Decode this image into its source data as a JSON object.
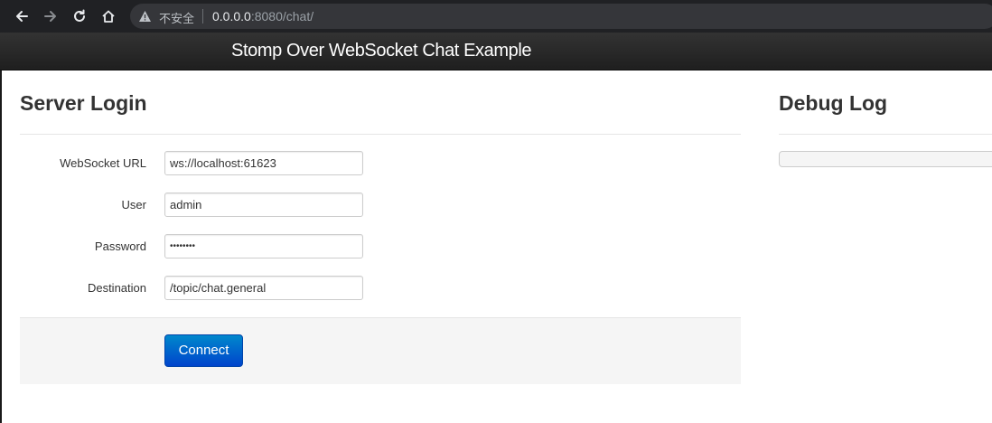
{
  "browser": {
    "security_label": "不安全",
    "url_host": "0.0.0.0",
    "url_rest": ":8080/chat/"
  },
  "navbar": {
    "brand": "Stomp Over WebSocket Chat Example"
  },
  "login": {
    "title": "Server Login",
    "fields": [
      {
        "label": "WebSocket URL",
        "value": "ws://localhost:61623"
      },
      {
        "label": "User",
        "value": "admin"
      },
      {
        "label": "Password",
        "value": "••••••••"
      },
      {
        "label": "Destination",
        "value": "/topic/chat.general"
      }
    ],
    "connect_label": "Connect"
  },
  "debug": {
    "title": "Debug Log",
    "log_text": ""
  },
  "colors": {
    "navbar": "#222222",
    "button_primary": "#0055cc",
    "actions_bg": "#f5f5f5"
  }
}
